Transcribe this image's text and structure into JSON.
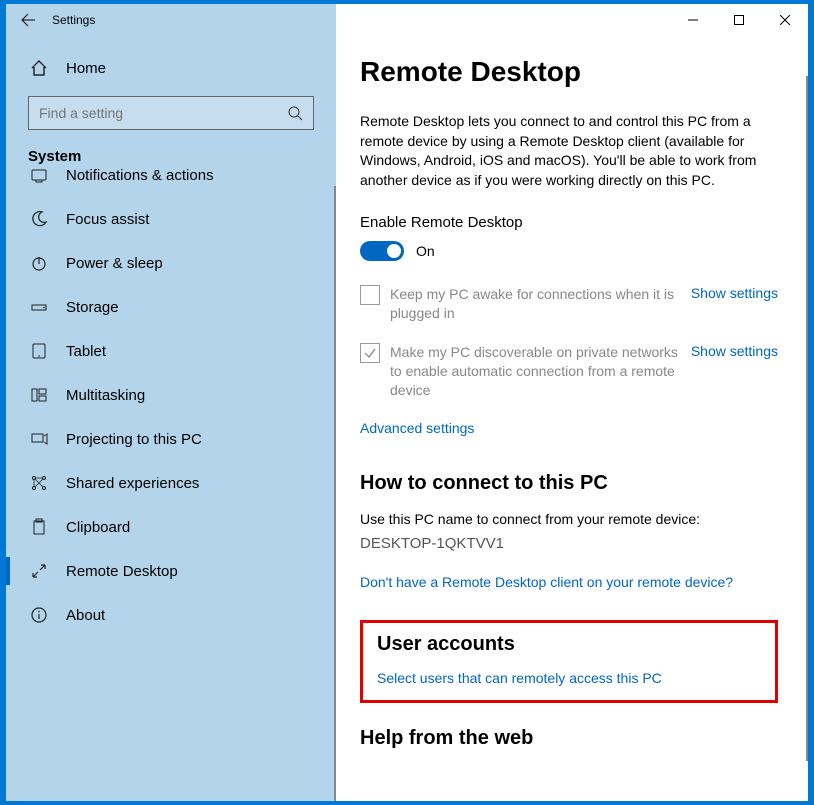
{
  "window": {
    "title": "Settings"
  },
  "sidebar": {
    "home": "Home",
    "search_placeholder": "Find a setting",
    "section": "System",
    "items": [
      {
        "label": "Notifications & actions",
        "icon": "bell",
        "cut": true
      },
      {
        "label": "Focus assist",
        "icon": "moon"
      },
      {
        "label": "Power & sleep",
        "icon": "power"
      },
      {
        "label": "Storage",
        "icon": "drive"
      },
      {
        "label": "Tablet",
        "icon": "tablet"
      },
      {
        "label": "Multitasking",
        "icon": "multitask"
      },
      {
        "label": "Projecting to this PC",
        "icon": "project"
      },
      {
        "label": "Shared experiences",
        "icon": "share"
      },
      {
        "label": "Clipboard",
        "icon": "clipboard"
      },
      {
        "label": "Remote Desktop",
        "icon": "remote",
        "active": true
      },
      {
        "label": "About",
        "icon": "info"
      }
    ]
  },
  "main": {
    "title": "Remote Desktop",
    "description": "Remote Desktop lets you connect to and control this PC from a remote device by using a Remote Desktop client (available for Windows, Android, iOS and macOS). You'll be able to work from another device as if you were working directly on this PC.",
    "enable_label": "Enable Remote Desktop",
    "toggle_state": "On",
    "option1": "Keep my PC awake for connections when it is plugged in",
    "option2": "Make my PC discoverable on private networks to enable automatic connection from a remote device",
    "show_settings": "Show settings",
    "advanced": "Advanced settings",
    "connect_header": "How to connect to this PC",
    "connect_text": "Use this PC name to connect from your remote device:",
    "pc_name": "DESKTOP-1QKTVV1",
    "client_link": "Don't have a Remote Desktop client on your remote device?",
    "users_header": "User accounts",
    "users_link": "Select users that can remotely access this PC",
    "help_header": "Help from the web"
  }
}
